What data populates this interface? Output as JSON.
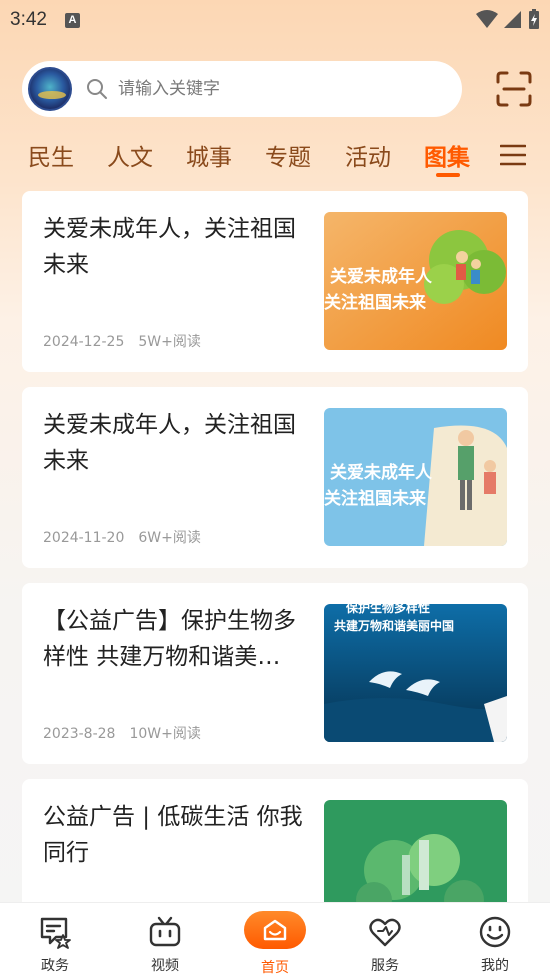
{
  "status": {
    "time": "3:42"
  },
  "search": {
    "placeholder": "请输入关键字"
  },
  "tabs": [
    {
      "label": "民生"
    },
    {
      "label": "人文"
    },
    {
      "label": "城事"
    },
    {
      "label": "专题"
    },
    {
      "label": "活动"
    },
    {
      "label": "图集",
      "active": true
    }
  ],
  "cards": [
    {
      "title": "关爱未成年人，关注祖国未来",
      "date": "2024-12-25",
      "reads": "5W+阅读",
      "thumb": {
        "headline_1": "关爱未成年人",
        "headline_2": "关注祖国未来"
      }
    },
    {
      "title": "关爱未成年人，关注祖国未来",
      "date": "2024-11-20",
      "reads": "6W+阅读",
      "thumb": {
        "headline_1": "关爱未成年人",
        "headline_2": "关注祖国未来"
      }
    },
    {
      "title": "【公益广告】保护生物多样性 共建万物和谐美丽中国",
      "date": "2023-8-28",
      "reads": "10W+阅读",
      "thumb": {
        "headline_1": "保护生物多样性",
        "headline_2": "共建万物和谐美丽中国"
      }
    },
    {
      "title": "公益广告 | 低碳生活 你我同行",
      "date": "",
      "reads": "",
      "thumb": {}
    }
  ],
  "nav": [
    {
      "label": "政务",
      "icon": "government-icon"
    },
    {
      "label": "视频",
      "icon": "tv-icon"
    },
    {
      "label": "首页",
      "icon": "home-icon",
      "active": true
    },
    {
      "label": "服务",
      "icon": "heart-icon"
    },
    {
      "label": "我的",
      "icon": "smile-icon"
    }
  ],
  "colors": {
    "accent": "#ff5a00",
    "tab_text": "#8a4a1c"
  }
}
